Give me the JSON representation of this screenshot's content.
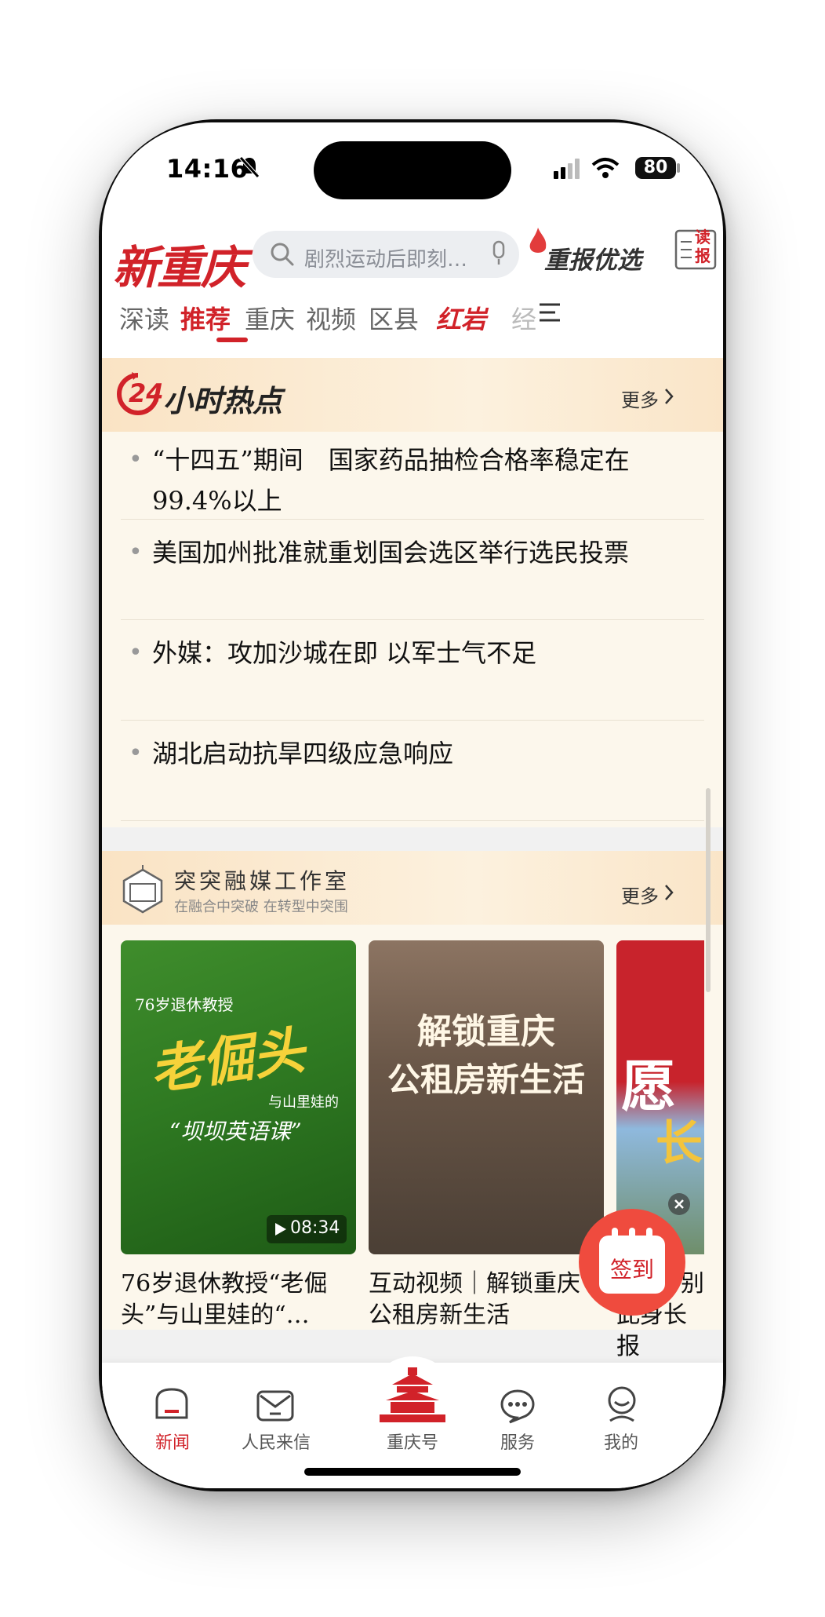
{
  "status_bar": {
    "time": "14:16",
    "battery": "80"
  },
  "header": {
    "logo": "新重庆",
    "search_placeholder": "剧烈运动后即刻…",
    "promo": "重报优选",
    "read_paper": "读报"
  },
  "tabs": [
    {
      "label": "深读"
    },
    {
      "label": "推荐"
    },
    {
      "label": "重庆"
    },
    {
      "label": "视频"
    },
    {
      "label": "区县"
    },
    {
      "label": "红岩"
    },
    {
      "label": "经"
    }
  ],
  "hot24": {
    "badge": "24",
    "title": "小时热点",
    "more": "更多",
    "items": [
      {
        "text": "“十四五”期间　国家药品抽检合格率稳定在99.4%以上"
      },
      {
        "text": "美国加州批准就重划国会选区举行选民投票"
      },
      {
        "text": "外媒：攻加沙城在即 以军士气不足"
      },
      {
        "text": "湖北启动抗旱四级应急响应"
      }
    ]
  },
  "studio": {
    "title": "突突融媒工作室",
    "subtitle": "在融合中突破 在转型中突围",
    "more": "更多",
    "videos": [
      {
        "overlay_line1": "76岁退休教授",
        "overlay_big": "老倔头",
        "overlay_line2": "与山里娃的",
        "overlay_line3": "“坝坝英语课”",
        "duration": "08:34",
        "caption_line1": "76岁退休教授“老倔",
        "caption_line2": "头”与山里娃的“…"
      },
      {
        "overlay_line1": "解锁重庆",
        "overlay_line2": "公租房新生活",
        "caption_line1": "互动视频｜解锁重庆",
        "caption_line2": "公租房新生活"
      },
      {
        "overlay_line1": "愿",
        "overlay_line2": "长",
        "caption_line1": "别",
        "caption_line2": "此身长报"
      }
    ]
  },
  "signin": {
    "label": "签到"
  },
  "tabbar": [
    {
      "label": "新闻"
    },
    {
      "label": "人民来信"
    },
    {
      "label": "重庆号"
    },
    {
      "label": "服务"
    },
    {
      "label": "我的"
    }
  ],
  "colors": {
    "brand_red": "#d12229",
    "cream": "#fcf7ec"
  }
}
